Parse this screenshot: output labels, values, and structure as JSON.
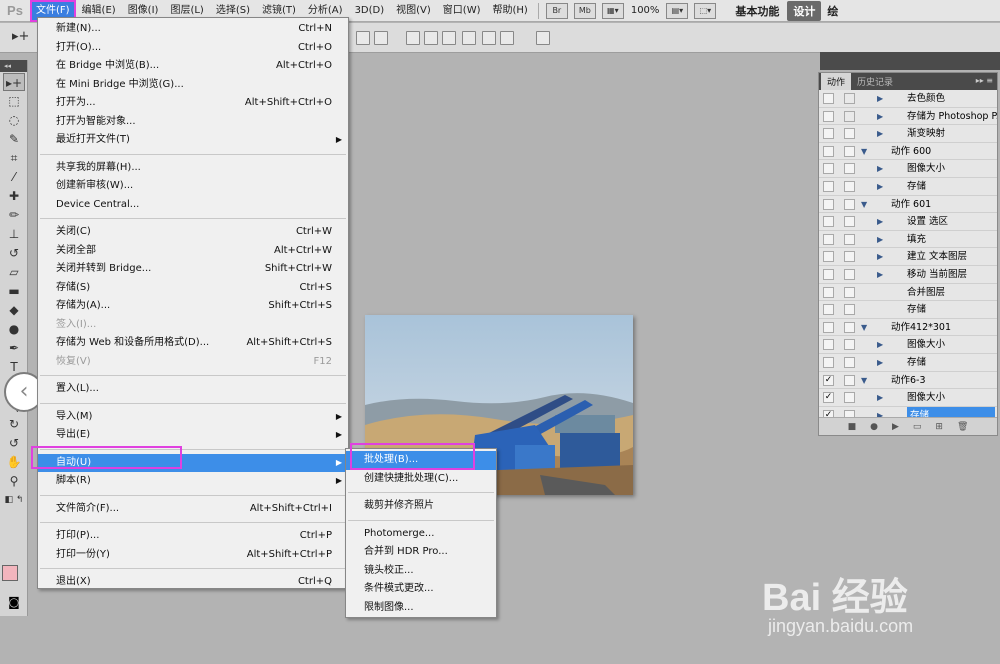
{
  "menubar": {
    "logo": "Ps",
    "items": [
      "文件(F)",
      "编辑(E)",
      "图像(I)",
      "图层(L)",
      "选择(S)",
      "滤镜(T)",
      "分析(A)",
      "3D(D)",
      "视图(V)",
      "窗口(W)",
      "帮助(H)"
    ],
    "btn_br": "Br",
    "btn_mb": "Mb",
    "zoom": "100%",
    "workspace_basic": "基本功能",
    "workspace_design": "设计",
    "workspace_more": "绘"
  },
  "file_menu": {
    "items": [
      {
        "label": "新建(N)...",
        "shortcut": "Ctrl+N"
      },
      {
        "label": "打开(O)...",
        "shortcut": "Ctrl+O"
      },
      {
        "label": "在 Bridge 中浏览(B)...",
        "shortcut": "Alt+Ctrl+O"
      },
      {
        "label": "在 Mini Bridge 中浏览(G)...",
        "shortcut": ""
      },
      {
        "label": "打开为...",
        "shortcut": "Alt+Shift+Ctrl+O"
      },
      {
        "label": "打开为智能对象...",
        "shortcut": ""
      },
      {
        "label": "最近打开文件(T)",
        "shortcut": ""
      },
      {
        "label": "共享我的屏幕(H)...",
        "shortcut": ""
      },
      {
        "label": "创建新审核(W)...",
        "shortcut": ""
      },
      {
        "label": "Device Central...",
        "shortcut": ""
      },
      {
        "label": "关闭(C)",
        "shortcut": "Ctrl+W"
      },
      {
        "label": "关闭全部",
        "shortcut": "Alt+Ctrl+W"
      },
      {
        "label": "关闭并转到 Bridge...",
        "shortcut": "Shift+Ctrl+W"
      },
      {
        "label": "存储(S)",
        "shortcut": "Ctrl+S"
      },
      {
        "label": "存储为(A)...",
        "shortcut": "Shift+Ctrl+S"
      },
      {
        "label": "签入(I)...",
        "shortcut": ""
      },
      {
        "label": "存储为 Web 和设备所用格式(D)...",
        "shortcut": "Alt+Shift+Ctrl+S"
      },
      {
        "label": "恢复(V)",
        "shortcut": "F12"
      },
      {
        "label": "置入(L)...",
        "shortcut": ""
      },
      {
        "label": "导入(M)",
        "shortcut": ""
      },
      {
        "label": "导出(E)",
        "shortcut": ""
      },
      {
        "label": "自动(U)",
        "shortcut": ""
      },
      {
        "label": "脚本(R)",
        "shortcut": ""
      },
      {
        "label": "文件简介(F)...",
        "shortcut": "Alt+Shift+Ctrl+I"
      },
      {
        "label": "打印(P)...",
        "shortcut": "Ctrl+P"
      },
      {
        "label": "打印一份(Y)",
        "shortcut": "Alt+Shift+Ctrl+P"
      },
      {
        "label": "退出(X)",
        "shortcut": "Ctrl+Q"
      }
    ]
  },
  "automate_submenu": {
    "items": [
      "批处理(B)...",
      "创建快捷批处理(C)...",
      "裁剪并修齐照片",
      "Photomerge...",
      "合并到 HDR Pro...",
      "镜头校正...",
      "条件模式更改...",
      "限制图像..."
    ]
  },
  "actions_panel": {
    "tabs": [
      "动作",
      "历史记录"
    ],
    "rows": [
      {
        "text": "去色颜色",
        "level": 1,
        "checked": false
      },
      {
        "text": "存储为 Photoshop P...",
        "level": 1,
        "checked": false
      },
      {
        "text": "渐变映射",
        "level": 1,
        "checked": false
      },
      {
        "text": "动作 600",
        "level": 0,
        "checked": false
      },
      {
        "text": "图像大小",
        "level": 1,
        "checked": false
      },
      {
        "text": "存储",
        "level": 1,
        "checked": false
      },
      {
        "text": "动作 601",
        "level": 0,
        "checked": false
      },
      {
        "text": "设置 选区",
        "level": 1,
        "checked": false
      },
      {
        "text": "填充",
        "level": 1,
        "checked": false
      },
      {
        "text": "建立 文本图层",
        "level": 1,
        "checked": false
      },
      {
        "text": "移动 当前图层",
        "level": 1,
        "checked": false
      },
      {
        "text": "合并图层",
        "level": 2,
        "checked": false
      },
      {
        "text": "存储",
        "level": 2,
        "checked": false
      },
      {
        "text": "动作412*301",
        "level": 0,
        "checked": false
      },
      {
        "text": "图像大小",
        "level": 1,
        "checked": false
      },
      {
        "text": "存储",
        "level": 1,
        "checked": false
      },
      {
        "text": "动作6-3",
        "level": 0,
        "checked": true
      },
      {
        "text": "图像大小",
        "level": 1,
        "checked": true
      },
      {
        "text": "存储",
        "level": 1,
        "checked": true,
        "selected": true
      }
    ]
  },
  "watermark": {
    "brand": "Bai 经验",
    "url": "jingyan.baidu.com"
  },
  "colors": {
    "highlight": "#3d8ee8",
    "annotation": "#e040e0",
    "foreground": "#f2b5bd"
  }
}
